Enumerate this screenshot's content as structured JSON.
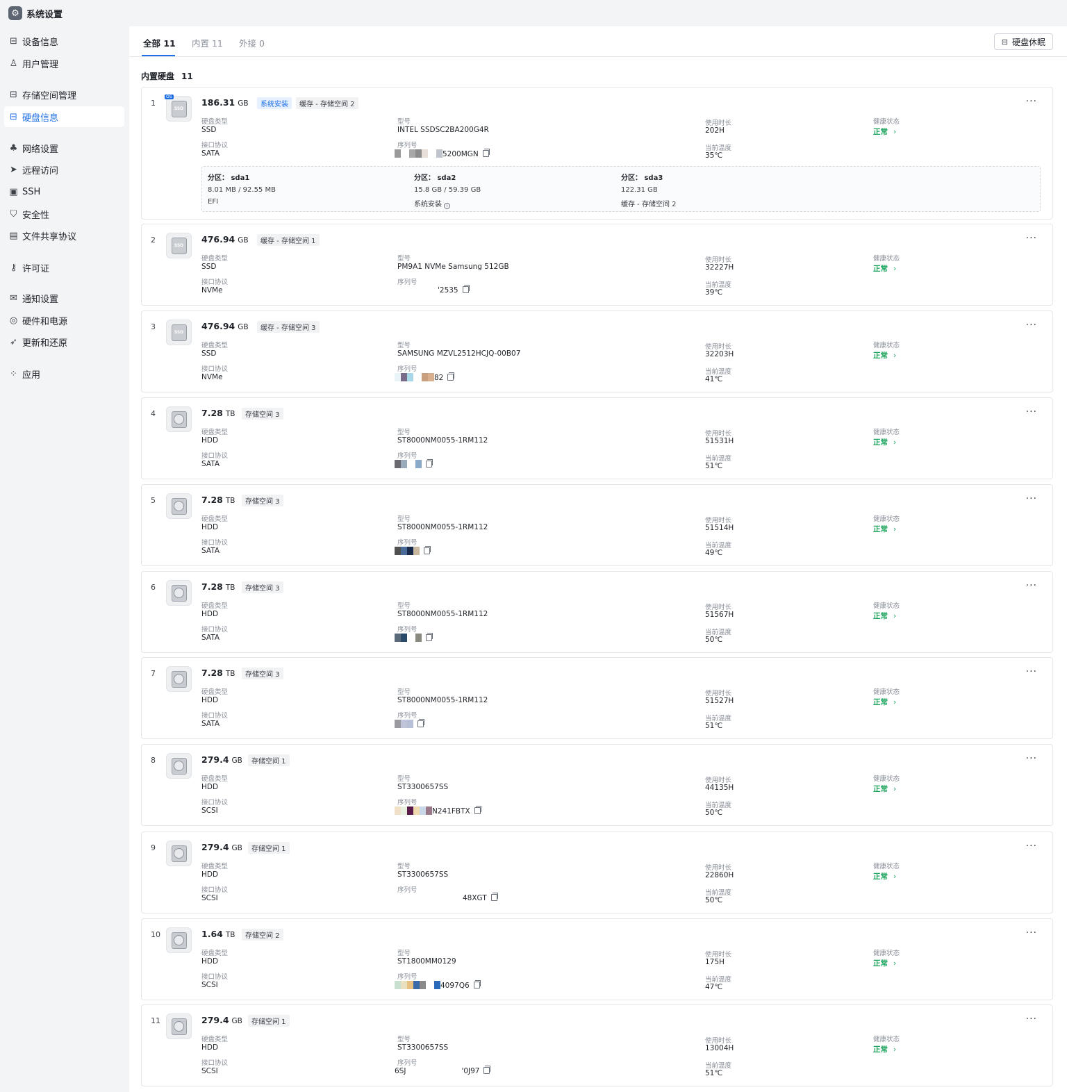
{
  "app": {
    "title": "系统设置",
    "icon": "gear-icon"
  },
  "sidebar": {
    "items": [
      {
        "label": "设备信息",
        "icon": "drive-icon",
        "active": false
      },
      {
        "label": "用户管理",
        "icon": "user-icon",
        "active": false
      },
      {
        "label": "存储空间管理",
        "icon": "storage-icon",
        "active": false
      },
      {
        "label": "硬盘信息",
        "icon": "disk-icon",
        "active": true
      },
      {
        "label": "网络设置",
        "icon": "network-icon",
        "active": false
      },
      {
        "label": "远程访问",
        "icon": "send-icon",
        "active": false
      },
      {
        "label": "SSH",
        "icon": "terminal-icon",
        "active": false
      },
      {
        "label": "安全性",
        "icon": "shield-icon",
        "active": false
      },
      {
        "label": "文件共享协议",
        "icon": "file-icon",
        "active": false
      },
      {
        "label": "许可证",
        "icon": "key-icon",
        "active": false
      },
      {
        "label": "通知设置",
        "icon": "mail-icon",
        "active": false
      },
      {
        "label": "硬件和电源",
        "icon": "power-icon",
        "active": false
      },
      {
        "label": "更新和还原",
        "icon": "rocket-icon",
        "active": false
      },
      {
        "label": "应用",
        "icon": "apps-icon",
        "active": false
      }
    ]
  },
  "tabs": [
    {
      "label": "全部 11",
      "active": true
    },
    {
      "label": "内置 11",
      "active": false
    },
    {
      "label": "外接 0",
      "active": false
    }
  ],
  "sleep_button": {
    "label": "硬盘休眠",
    "icon": "disk-sleep-icon"
  },
  "section": {
    "title": "内置硬盘",
    "count": "11"
  },
  "labels": {
    "type": "硬盘类型",
    "protocol": "接口协议",
    "model": "型号",
    "serial": "序列号",
    "usage": "使用时长",
    "temp": "当前温度",
    "health": "健康状态"
  },
  "disks": [
    {
      "index": "1",
      "kind": "SSD",
      "os": true,
      "capacity": "186.31",
      "unit": "GB",
      "tags": [
        "系统安装",
        "缓存 - 存储空间 2"
      ],
      "type": "SSD",
      "protocol": "SATA",
      "model": "INTEL SSDSC2BA200G4R",
      "serial": "5200MGN",
      "usage": "202H",
      "temp": "35℃",
      "health": "正常",
      "partitions": [
        {
          "title": "分区： sda1",
          "size": "8.01 MB / 92.55 MB",
          "note": "EFI"
        },
        {
          "title": "分区： sda2",
          "size": "15.8 GB / 59.39 GB",
          "note": "系统安装"
        },
        {
          "title": "分区： sda3",
          "size": "122.31 GB",
          "note": "缓存 - 存储空间 2"
        }
      ]
    },
    {
      "index": "2",
      "kind": "SSD",
      "capacity": "476.94",
      "unit": "GB",
      "tags": [
        "缓存 - 存储空间 1"
      ],
      "type": "SSD",
      "protocol": "NVMe",
      "model": "PM9A1 NVMe Samsung 512GB",
      "serial": "'2535",
      "usage": "32227H",
      "temp": "39℃",
      "health": "正常"
    },
    {
      "index": "3",
      "kind": "SSD",
      "capacity": "476.94",
      "unit": "GB",
      "tags": [
        "缓存 - 存储空间 3"
      ],
      "type": "SSD",
      "protocol": "NVMe",
      "model": "SAMSUNG MZVL2512HCJQ-00B07",
      "serial": "82",
      "usage": "32203H",
      "temp": "41℃",
      "health": "正常"
    },
    {
      "index": "4",
      "kind": "HDD",
      "capacity": "7.28",
      "unit": "TB",
      "tags": [
        "存储空间 3"
      ],
      "type": "HDD",
      "protocol": "SATA",
      "model": "ST8000NM0055-1RM112",
      "serial": "",
      "usage": "51531H",
      "temp": "51℃",
      "health": "正常"
    },
    {
      "index": "5",
      "kind": "HDD",
      "capacity": "7.28",
      "unit": "TB",
      "tags": [
        "存储空间 3"
      ],
      "type": "HDD",
      "protocol": "SATA",
      "model": "ST8000NM0055-1RM112",
      "serial": "",
      "usage": "51514H",
      "temp": "49℃",
      "health": "正常"
    },
    {
      "index": "6",
      "kind": "HDD",
      "capacity": "7.28",
      "unit": "TB",
      "tags": [
        "存储空间 3"
      ],
      "type": "HDD",
      "protocol": "SATA",
      "model": "ST8000NM0055-1RM112",
      "serial": "",
      "usage": "51567H",
      "temp": "50℃",
      "health": "正常"
    },
    {
      "index": "7",
      "kind": "HDD",
      "capacity": "7.28",
      "unit": "TB",
      "tags": [
        "存储空间 3"
      ],
      "type": "HDD",
      "protocol": "SATA",
      "model": "ST8000NM0055-1RM112",
      "serial": "",
      "usage": "51527H",
      "temp": "51℃",
      "health": "正常"
    },
    {
      "index": "8",
      "kind": "HDD",
      "capacity": "279.4",
      "unit": "GB",
      "tags": [
        "存储空间 1"
      ],
      "type": "HDD",
      "protocol": "SCSI",
      "model": "ST3300657SS",
      "serial": "N241FBTX",
      "usage": "44135H",
      "temp": "50℃",
      "health": "正常"
    },
    {
      "index": "9",
      "kind": "HDD",
      "capacity": "279.4",
      "unit": "GB",
      "tags": [
        "存储空间 1"
      ],
      "type": "HDD",
      "protocol": "SCSI",
      "model": "ST3300657SS",
      "serial": "48XGT",
      "usage": "22860H",
      "temp": "50℃",
      "health": "正常"
    },
    {
      "index": "10",
      "kind": "HDD",
      "capacity": "1.64",
      "unit": "TB",
      "tags": [
        "存储空间 2"
      ],
      "type": "HDD",
      "protocol": "SCSI",
      "model": "ST1800MM0129",
      "serial": "4097Q6",
      "usage": "175H",
      "temp": "47℃",
      "health": "正常"
    },
    {
      "index": "11",
      "kind": "HDD",
      "capacity": "279.4",
      "unit": "GB",
      "tags": [
        "存储空间 1"
      ],
      "type": "HDD",
      "protocol": "SCSI",
      "model": "ST3300657SS",
      "serial": "6SJ",
      "serial_suffix": "'0J97",
      "usage": "13004H",
      "temp": "51℃",
      "health": "正常"
    }
  ]
}
